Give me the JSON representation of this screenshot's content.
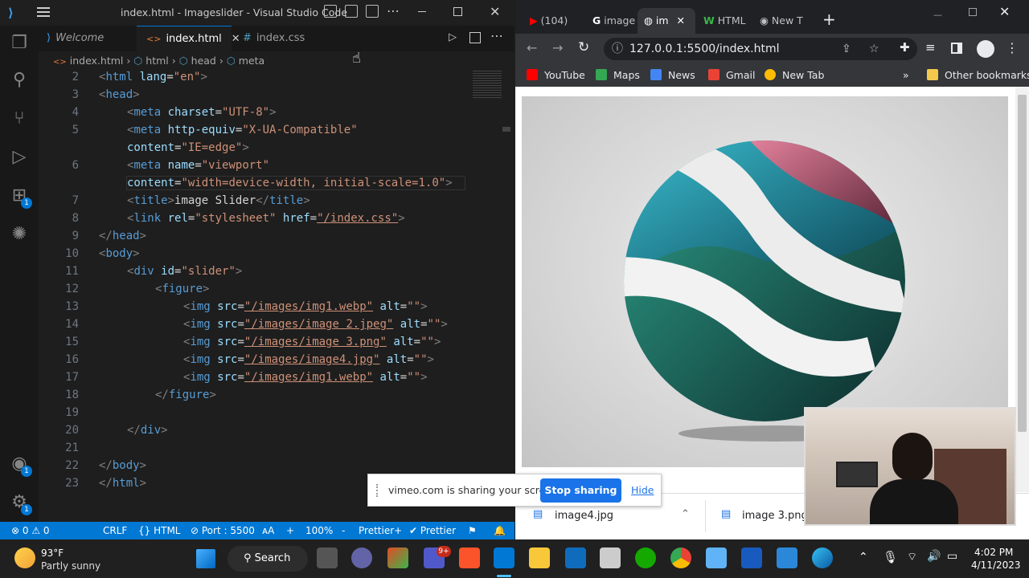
{
  "vscode": {
    "window_title": "index.html - Imageslider - Visual Studio Code",
    "tabs": [
      {
        "label": "Welcome"
      },
      {
        "label": "index.html"
      },
      {
        "label": "index.css"
      }
    ],
    "breadcrumb": [
      "index.html",
      "html",
      "head",
      "meta"
    ],
    "activity_badges": {
      "extensions": "1",
      "accounts": "1",
      "settings": "1"
    },
    "code_lines": [
      {
        "n": "2"
      },
      {
        "n": "3"
      },
      {
        "n": "4"
      },
      {
        "n": "5"
      },
      {
        "n": ""
      },
      {
        "n": "6"
      },
      {
        "n": ""
      },
      {
        "n": "7"
      },
      {
        "n": "8"
      },
      {
        "n": "9"
      },
      {
        "n": "10"
      },
      {
        "n": "11"
      },
      {
        "n": "12"
      },
      {
        "n": "13"
      },
      {
        "n": "14"
      },
      {
        "n": "15"
      },
      {
        "n": "16"
      },
      {
        "n": "17"
      },
      {
        "n": "18"
      },
      {
        "n": "19"
      },
      {
        "n": "20"
      },
      {
        "n": "21"
      },
      {
        "n": "22"
      },
      {
        "n": "23"
      }
    ],
    "code_text": {
      "l2": {
        "tag": "html",
        "attr": "lang",
        "val": "\"en\""
      },
      "l4": {
        "tag": "meta",
        "attr": "charset",
        "val": "\"UTF-8\""
      },
      "l5": {
        "tag": "meta",
        "attr": "http-equiv",
        "val": "\"X-UA-Compatible\"",
        "attr2": "content",
        "val2": "\"IE=edge\""
      },
      "l6": {
        "tag": "meta",
        "attr": "name",
        "val": "\"viewport\"",
        "attr2": "content",
        "val2": "\"width=device-width, initial-scale=1.0\""
      },
      "l7": {
        "text": "image Slider"
      },
      "l8": {
        "tag": "link",
        "attr": "rel",
        "val": "\"stylesheet\"",
        "attr2": "href",
        "val2": "\"/index.css\""
      },
      "l11": {
        "tag": "div",
        "attr": "id",
        "val": "\"slider\""
      },
      "imgs": [
        "\"/images/img1.webp\"",
        "\"/images/image 2.jpeg\"",
        "\"/images/image 3.png\"",
        "\"/images/image4.jpg\"",
        "\"/images/img1.webp\""
      ]
    },
    "status": {
      "problems": "0",
      "warnings": "0",
      "eol": "CRLF",
      "language": "HTML",
      "port": "Port : 5500",
      "zoom": "100%",
      "prettier_plus": "Prettier+",
      "prettier": "Prettier"
    }
  },
  "chrome": {
    "tabs": [
      {
        "label": "(104)",
        "icon": "youtube-icon"
      },
      {
        "label": "image",
        "icon": "google-icon"
      },
      {
        "label": "im",
        "icon": "globe-icon"
      },
      {
        "label": "HTML",
        "icon": "w-icon"
      },
      {
        "label": "New T",
        "icon": "chrome-icon"
      }
    ],
    "url": "127.0.0.1:5500/index.html",
    "profile_initial": "",
    "bookmarks": [
      "YouTube",
      "Maps",
      "News",
      "Gmail",
      "New Tab"
    ],
    "other_bookmarks": "Other bookmarks",
    "share_text": "vimeo.com is sharing your screen.",
    "stop_sharing": "Stop sharing",
    "hide": "Hide",
    "downloads": [
      "image4.jpg",
      "image 3.png"
    ]
  },
  "taskbar": {
    "weather_temp": "93°F",
    "weather_desc": "Partly sunny",
    "search": "Search",
    "teams_badge": "9+",
    "time": "4:02 PM",
    "date": "4/11/2023"
  }
}
